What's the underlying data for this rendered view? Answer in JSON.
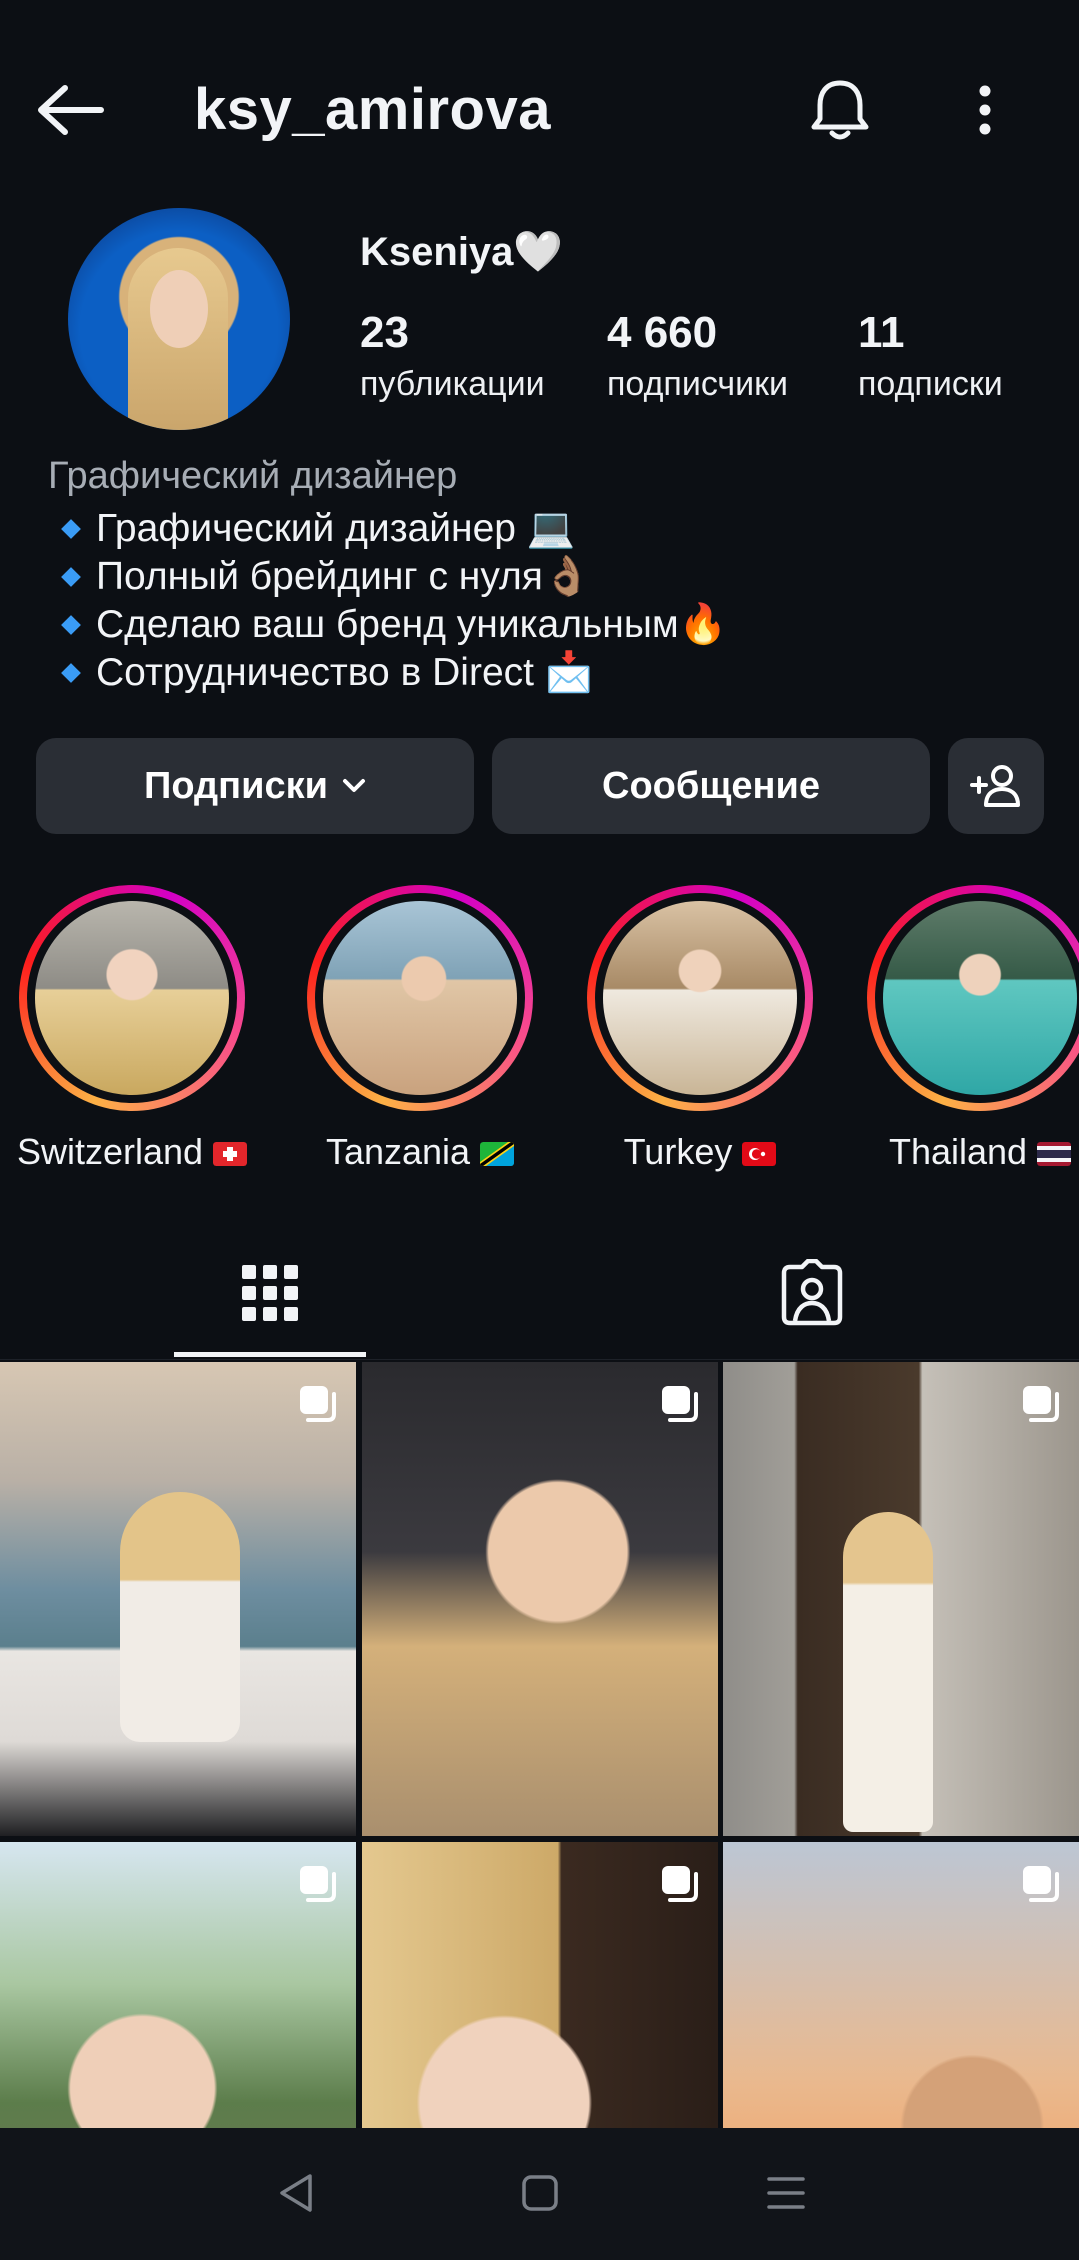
{
  "header": {
    "username": "ksy_amirova"
  },
  "profile": {
    "display_name": "Kseniya🤍",
    "stats": {
      "posts": {
        "value": "23",
        "label": "публикации"
      },
      "followers": {
        "value": "4 660",
        "label": "подписчики"
      },
      "following": {
        "value": "11",
        "label": "подписки"
      }
    },
    "category": "Графический дизайнер",
    "bio": [
      "Графический дизайнер 💻",
      "Полный брейдинг с нуля👌🏽",
      "Сделаю ваш бренд уникальным🔥",
      "Сотрудничество в Direct 📩"
    ]
  },
  "actions": {
    "following_label": "Подписки",
    "message_label": "Сообщение"
  },
  "highlights": [
    {
      "label": "Switzerland"
    },
    {
      "label": "Tanzania"
    },
    {
      "label": "Turkey"
    },
    {
      "label": "Thailand"
    }
  ],
  "tabs": [
    "grid-icon",
    "tagged-icon"
  ],
  "colors": {
    "background": "#0c0f14",
    "button": "#2a2e35",
    "category_text": "#a7adb5",
    "bio_bullet": "#3a9cf6"
  }
}
